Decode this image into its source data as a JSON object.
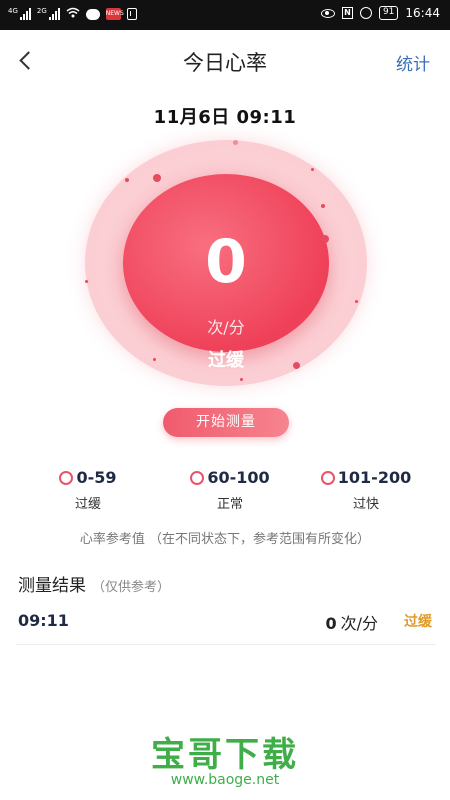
{
  "status_bar": {
    "net1": "4G",
    "net2": "2G",
    "app_badge": "NEWS",
    "nfc": "N",
    "battery": "91",
    "time": "16:44"
  },
  "header": {
    "title": "今日心率",
    "stats_label": "统计"
  },
  "datetime": "11月6日 09:11",
  "gauge": {
    "value": "0",
    "unit": "次/分",
    "status": "过缓"
  },
  "start_button": "开始测量",
  "ranges": [
    {
      "range": "0-59",
      "label": "过缓"
    },
    {
      "range": "60-100",
      "label": "正常"
    },
    {
      "range": "101-200",
      "label": "过快"
    }
  ],
  "ranges_note": "心率参考值 （在不同状态下，参考范围有所变化）",
  "results": {
    "title": "测量结果",
    "subtitle": "（仅供参考）",
    "rows": [
      {
        "time": "09:11",
        "value": "0",
        "unit": "次/分",
        "status": "过缓"
      }
    ]
  },
  "watermark": {
    "text": "宝哥下载",
    "url": "www.baoge.net"
  },
  "colors": {
    "accent": "#ef4159",
    "link": "#3b6fb6",
    "status_slow": "#e09a2a",
    "watermark": "#3fae49"
  }
}
